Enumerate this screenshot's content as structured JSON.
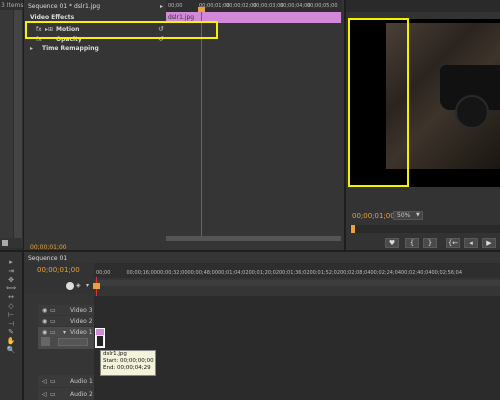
{
  "project_panel": {
    "items_label": "3 Items"
  },
  "effect_controls": {
    "tab_label": "Sequence 01 * dslr1.jpg",
    "section_label": "Video Effects",
    "effects": [
      {
        "name": "Motion"
      },
      {
        "name": "Opacity"
      },
      {
        "name": "Time Remapping"
      }
    ],
    "clip_label": "dslr1.jpg",
    "timecode": "00;00;01;00",
    "ruler_ticks": [
      "00;00",
      "00;00;01;00",
      "00;00;02;00",
      "00;00;03;00",
      "00;00;04;00",
      "00;00;05;00"
    ]
  },
  "program_monitor": {
    "timecode": "00;00;01;00",
    "zoom": "50%"
  },
  "timeline": {
    "tab_label": "Sequence 01",
    "timecode": "00;00;01;00",
    "ruler_ticks": [
      "00;00",
      "00;00;16;00",
      "00;00;32;00",
      "00;00;48;00",
      "00;01;04;02",
      "00;01;20;02",
      "00;01;36;02",
      "00;01;52;02",
      "00;02;08;04",
      "00;02;24;04",
      "00;02;40;04",
      "00;02;56;04"
    ],
    "tracks": [
      {
        "name": "Video 3"
      },
      {
        "name": "Video 2"
      },
      {
        "name": "Video 1"
      },
      {
        "name": "Audio 1"
      },
      {
        "name": "Audio 2"
      }
    ],
    "clip_label": "dslr1.jpg",
    "tooltip": {
      "name": "dslr1.jpg",
      "start": "Start: 00;00;00;00",
      "end": "End: 00;00;04;29"
    }
  },
  "tools": {
    "icons": [
      "selection-tool",
      "track-select-tool",
      "ripple-edit-tool",
      "rolling-edit-tool",
      "rate-stretch-tool",
      "razor-tool",
      "slip-tool",
      "slide-tool",
      "pen-tool",
      "hand-tool",
      "zoom-tool"
    ],
    "glyphs": [
      "▸",
      "⇥",
      "✥",
      "⟺",
      "↔",
      "◇",
      "⊢",
      "⊣",
      "✎",
      "✋",
      "🔍"
    ]
  },
  "colors": {
    "timecode": "#e8a33a",
    "highlight": "#f5f100",
    "clip_pink": "#d28ad8",
    "playhead": "#d33"
  }
}
